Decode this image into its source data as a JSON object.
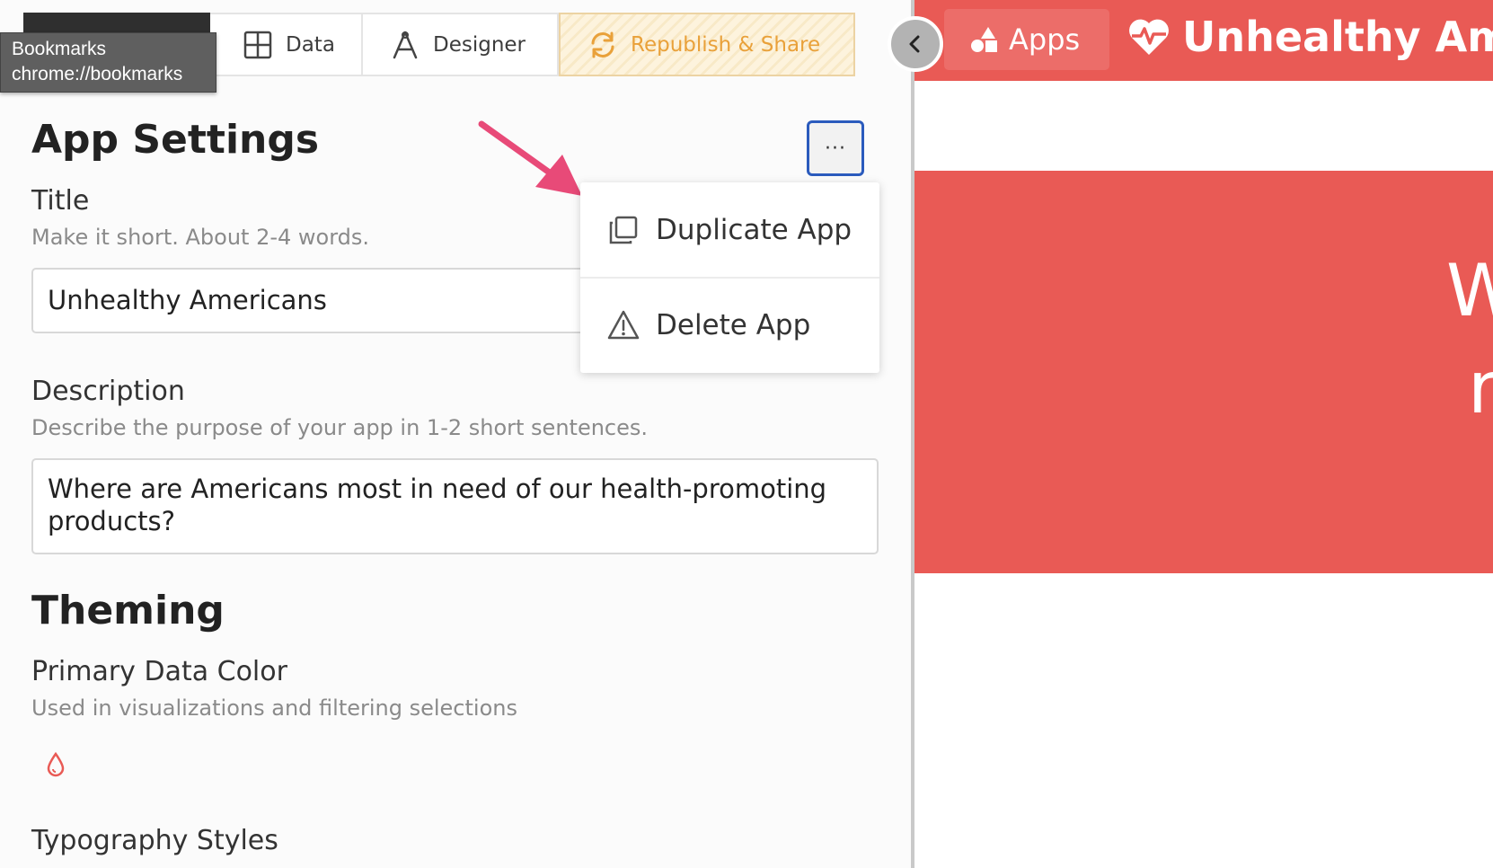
{
  "tooltip": {
    "line1": "Bookmarks",
    "line2": "chrome://bookmarks"
  },
  "tabs": [
    {
      "label": "",
      "icon": "dashboard-icon"
    },
    {
      "label": "Data",
      "icon": "table-icon"
    },
    {
      "label": "Designer",
      "icon": "designer-icon"
    },
    {
      "label": "Republish & Share",
      "icon": "refresh-icon"
    }
  ],
  "settings": {
    "heading": "App Settings",
    "title_label": "Title",
    "title_help": "Make it short. About 2-4 words.",
    "title_value": "Unhealthy Americans",
    "description_label": "Description",
    "description_help": "Describe the purpose of your app in 1-2 short sentences.",
    "description_value": "Where are Americans most in need of our health-promoting products?",
    "more_button": "···"
  },
  "theming": {
    "heading": "Theming",
    "primary_color_label": "Primary Data Color",
    "primary_color_help": "Used in visualizations and filtering selections",
    "primary_color": "#e95a55",
    "typography_label": "Typography Styles"
  },
  "menu": {
    "items": [
      {
        "label": "Duplicate App",
        "icon": "duplicate-icon"
      },
      {
        "label": "Delete App",
        "icon": "warning-icon"
      }
    ]
  },
  "preview": {
    "apps_label": "Apps",
    "app_title": "Unhealthy Ame",
    "hero_text_line1": "W",
    "hero_text_line2": "r",
    "brand_color": "#e95a55"
  },
  "colors": {
    "accent_blue": "#2b5bbd",
    "republish_orange": "#e9a13a",
    "arrow_pink": "#e84a78"
  }
}
